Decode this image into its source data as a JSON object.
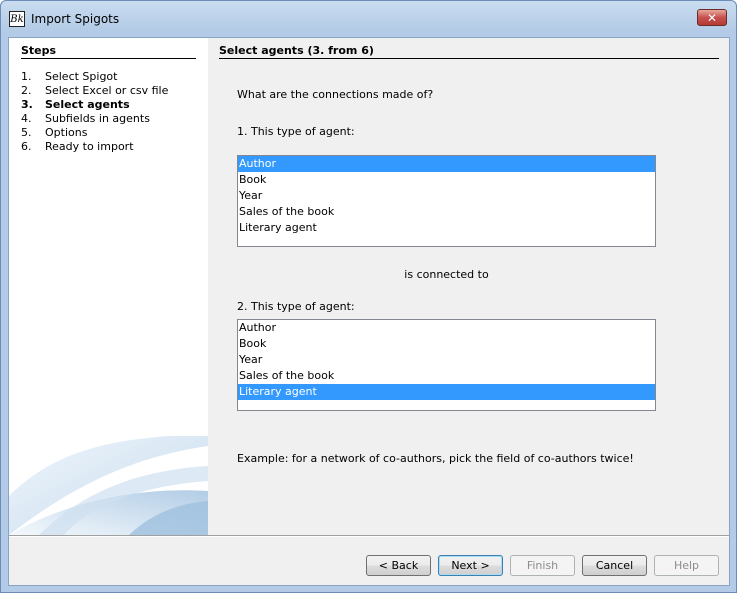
{
  "window": {
    "title": "Import Spigots",
    "close_label": "✕",
    "app_icon_glyph": "Bk"
  },
  "sidebar": {
    "title": "Steps",
    "steps": [
      {
        "num": "1.",
        "label": "Select Spigot"
      },
      {
        "num": "2.",
        "label": "Select Excel or csv file"
      },
      {
        "num": "3.",
        "label": "Select agents"
      },
      {
        "num": "4.",
        "label": "Subfields in agents"
      },
      {
        "num": "5.",
        "label": "Options"
      },
      {
        "num": "6.",
        "label": "Ready to import"
      }
    ]
  },
  "main": {
    "title": "Select agents (3. from 6)",
    "question": "What are the connections made of?",
    "label1": "1.  This type of agent:",
    "list1": [
      "Author",
      "Book",
      "Year",
      "Sales of the book",
      "Literary agent"
    ],
    "connected_label": "is connected to",
    "label2": "2. This type of agent:",
    "list2": [
      "Author",
      "Book",
      "Year",
      "Sales of the book",
      "Literary agent"
    ],
    "example": "Example: for a network of co-authors, pick the field of co-authors twice!"
  },
  "buttons": {
    "back": "< Back",
    "next": "Next >",
    "finish": "Finish",
    "cancel": "Cancel",
    "help": "Help"
  },
  "colors": {
    "selection": "#3399ff",
    "panel": "#f0f0f0"
  }
}
